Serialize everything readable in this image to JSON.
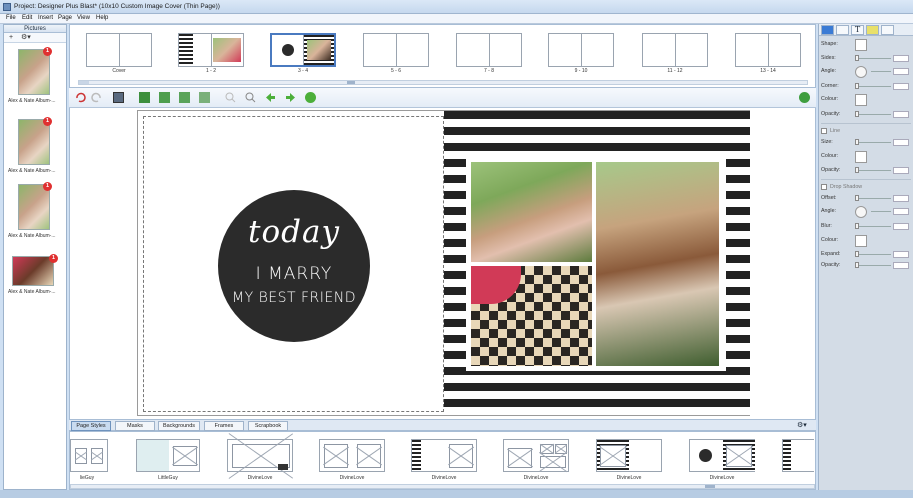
{
  "window": {
    "title": "Project: Designer Plus Blast* (10x10 Custom Image Cover (Thin Page))"
  },
  "menu": [
    "File",
    "Edit",
    "Insert",
    "Page",
    "View",
    "Help"
  ],
  "pictures_panel": {
    "header": "Pictures",
    "items": [
      {
        "label": "Alex & Nate Album-...",
        "badge": "1"
      },
      {
        "label": "Alex & Nate Album-...",
        "badge": "1"
      },
      {
        "label": "Alex & Nate Album-...",
        "badge": "1"
      },
      {
        "label": "Alex & Nate Album-...",
        "badge": "1"
      }
    ]
  },
  "pages": [
    "Cover",
    "1 - 2",
    "3 - 4",
    "5 - 6",
    "7 - 8",
    "9 - 10",
    "11 - 12",
    "13 - 14"
  ],
  "spread_text": {
    "line1": "today",
    "line2": "I MARRY",
    "line3": "MY BEST FRIEND"
  },
  "bottom_tabs": [
    "Page Styles",
    "Masks",
    "Backgrounds",
    "Frames",
    "Scrapbook"
  ],
  "page_styles": [
    "lieGuy",
    "LittleGuy",
    "DivineLove",
    "DivineLove",
    "DivineLove",
    "DivineLove",
    "DivineLove",
    "DivineLove"
  ],
  "properties": {
    "shape": "Shape:",
    "sides": "Sides:",
    "angle": "Angle:",
    "corner": "Corner:",
    "colour": "Colour:",
    "opacity": "Opacity:",
    "line": "Line",
    "size": "Size:",
    "line_colour": "Colour:",
    "line_opacity": "Opacity:",
    "drop_shadow": "Drop Shadow",
    "offset": "Offset:",
    "shadow_angle": "Angle:",
    "blur": "Blur:",
    "shadow_colour": "Colour:",
    "expand": "Expand:",
    "shadow_opacity": "Opacity:"
  },
  "colors": {
    "accent": "#2b2b2b",
    "panel": "#d3dce6",
    "selection": "#4a7ac0"
  }
}
